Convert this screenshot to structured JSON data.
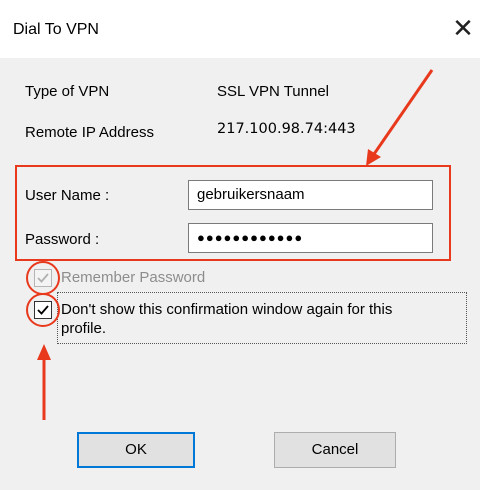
{
  "window": {
    "title": "Dial To VPN",
    "close_glyph": "✕"
  },
  "info": {
    "type_label": "Type of VPN",
    "type_value": "SSL VPN Tunnel",
    "ip_label": "Remote IP Address",
    "ip_value": "217.100.98.74:443"
  },
  "credentials": {
    "username_label": "User Name :",
    "username_value": "gebruikersnaam",
    "password_label": "Password :",
    "password_value": "●●●●●●●●●●●●"
  },
  "options": {
    "remember_label": "Remember Password",
    "remember_checked": true,
    "remember_disabled": true,
    "dont_show_line1": "Don't show this confirmation window again for this",
    "dont_show_line2": "profile.",
    "dont_show_checked": true
  },
  "buttons": {
    "ok_label": "OK",
    "cancel_label": "Cancel"
  },
  "colors": {
    "annotation": "#e8391d",
    "default_button_border": "#0078d7"
  }
}
